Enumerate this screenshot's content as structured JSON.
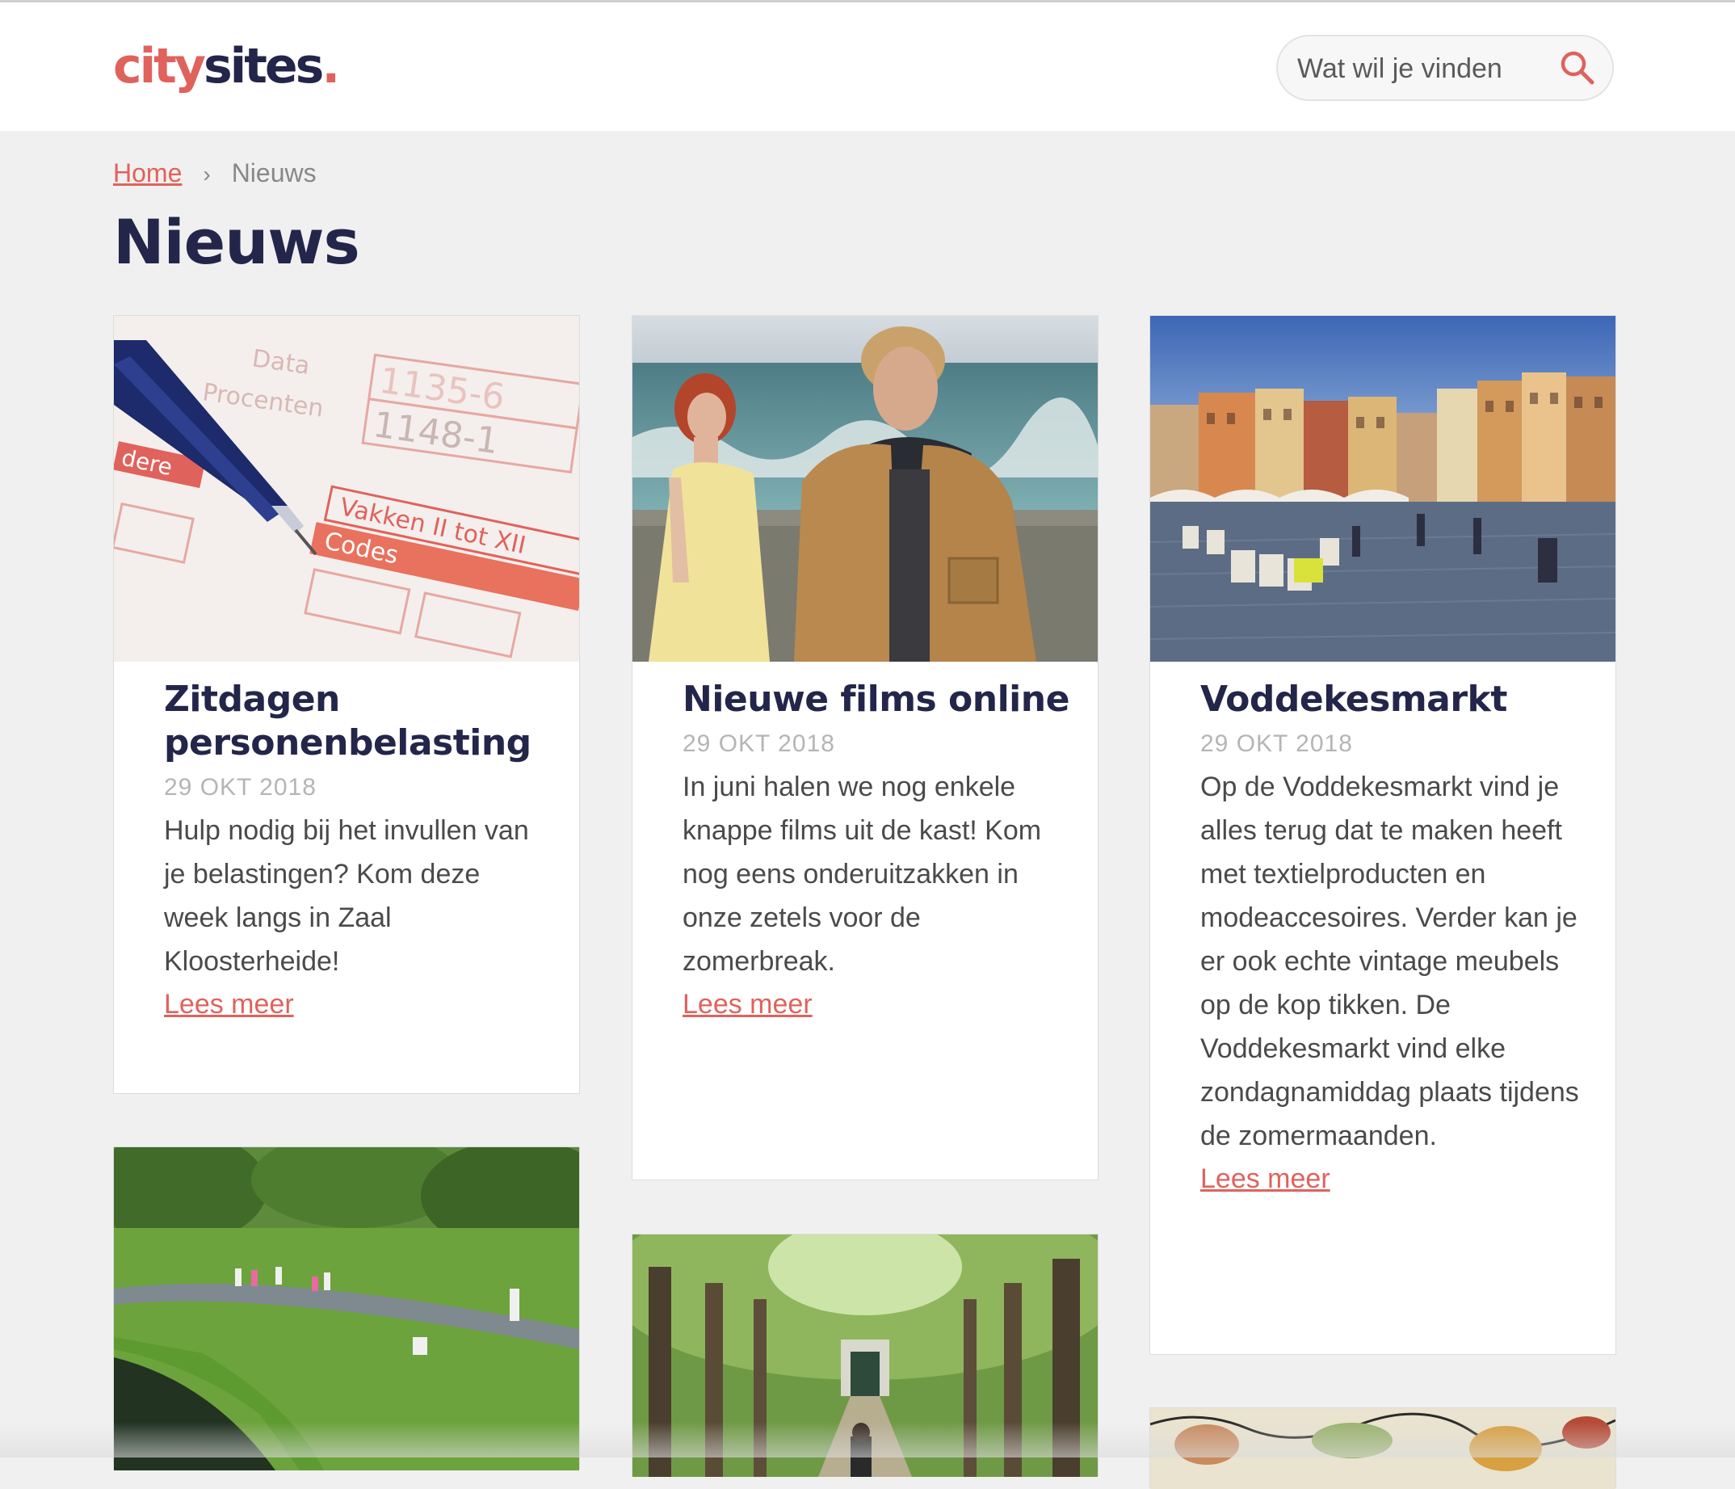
{
  "brand": {
    "logo_city": "city",
    "logo_sites": "sites",
    "logo_dot": "."
  },
  "search": {
    "placeholder": "Wat wil je vinden"
  },
  "breadcrumb": {
    "home": "Home",
    "separator": "›",
    "current": "Nieuws"
  },
  "page": {
    "title": "Nieuws"
  },
  "colors": {
    "accent": "#e0625c",
    "heading": "#23264a",
    "background": "#f0f0f0"
  },
  "cards": [
    {
      "title": "Zitdagen personenbelasting",
      "date": "29 OKT 2018",
      "description": "Hulp nodig bij het invullen van je belastingen? Kom deze week langs in Zaal Kloosterheide!",
      "link": "Lees meer",
      "image": "tax-form-with-pen-photo",
      "image_text": {
        "line1": "Data",
        "line2": "Procenten",
        "line3": "Vakken II tot XII",
        "line4": "Codes",
        "line5": "dere"
      }
    },
    {
      "title": "Nieuwe films online",
      "date": "29 OKT 2018",
      "description": "In juni halen we nog enkele knappe films uit de kast! Kom nog eens onderuitzakken in onze zetels voor de zomerbreak.",
      "link": "Lees meer",
      "image": "couple-at-sea-film-still-photo"
    },
    {
      "title": "Voddekesmarkt",
      "date": "29 OKT 2018",
      "description": "Op de Voddekesmarkt vind je alles terug dat te maken heeft met textielproducten en modeaccesoires. Verder kan je er ook echte vintage meubels op de kop tikken. De Voddekesmarkt vind elke zondagnamiddag plaats tijdens de zomermaanden.",
      "link": "Lees meer",
      "image": "old-town-market-square-photo"
    },
    {
      "image": "park-with-pond-photo"
    },
    {
      "image": "forest-lane-photo"
    },
    {
      "image": "illustration-photo"
    }
  ]
}
